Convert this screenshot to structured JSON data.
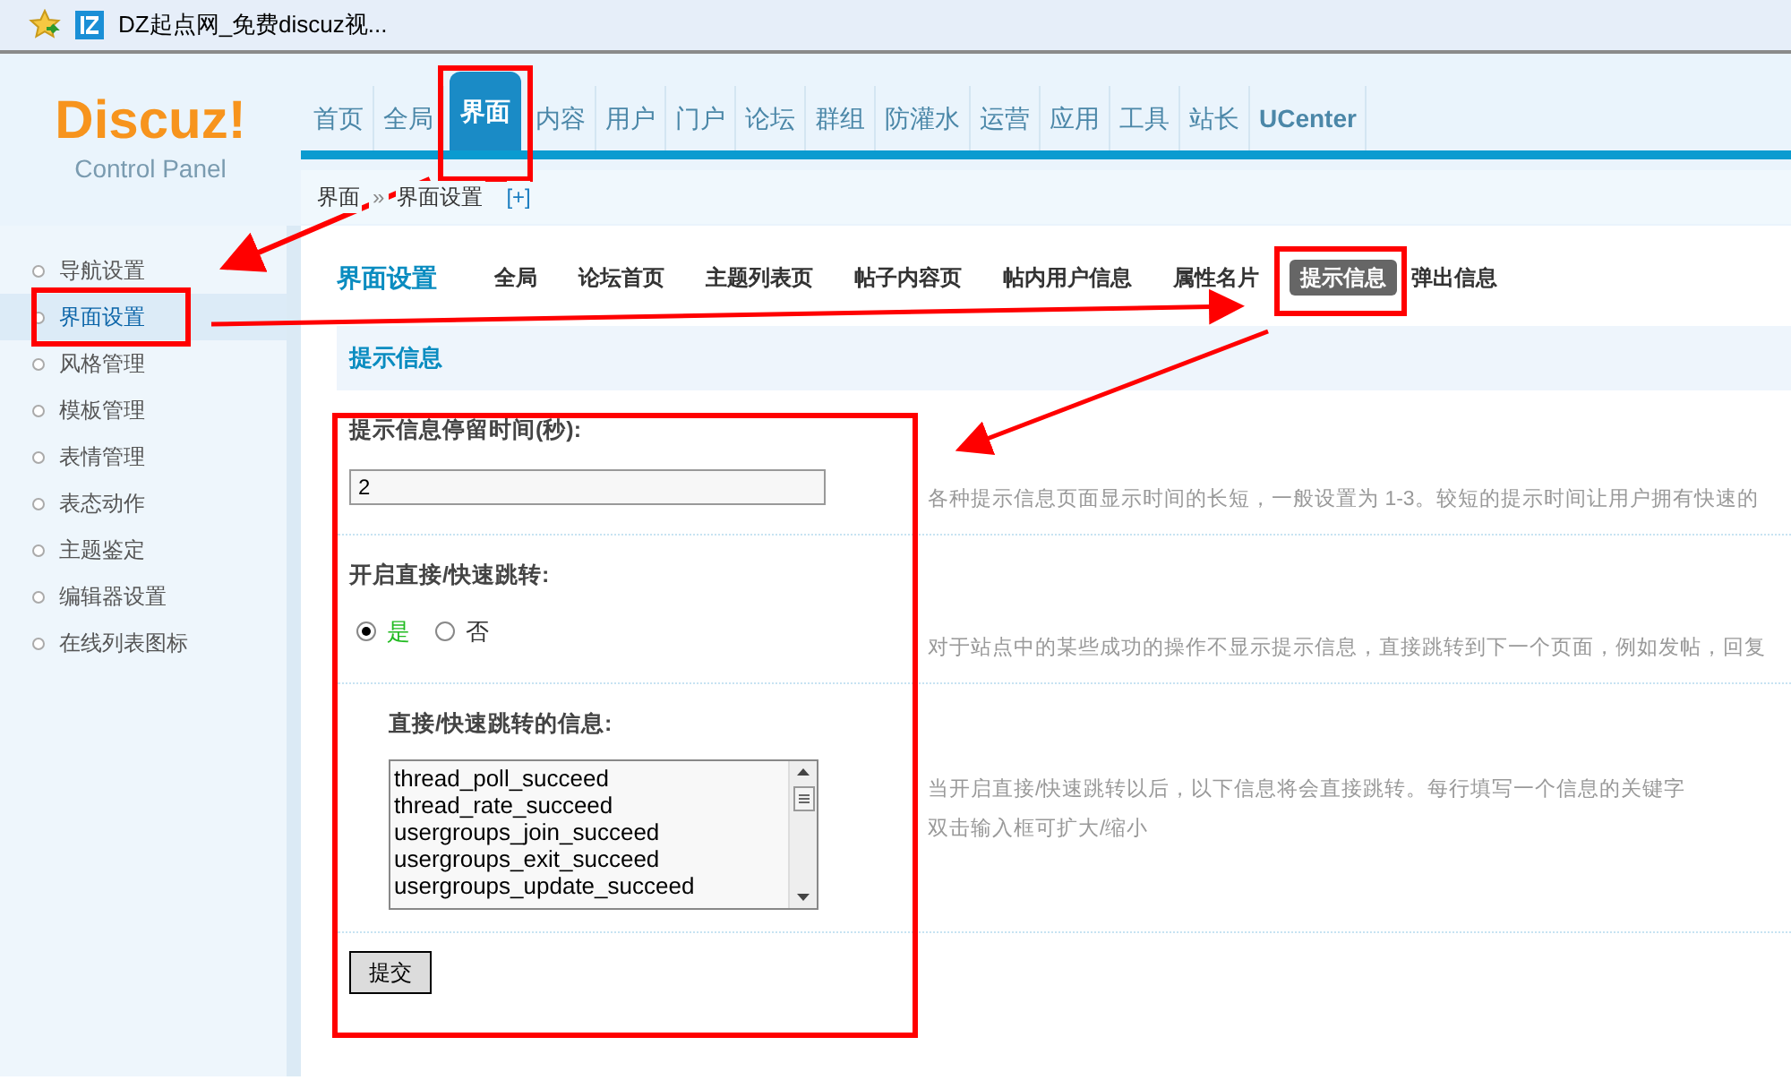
{
  "browser_tab": {
    "title": "DZ起点网_免费discuz视..."
  },
  "logo": {
    "name": "Discuz!",
    "subtitle": "Control Panel"
  },
  "nav": {
    "items": [
      {
        "label": "首页",
        "selected": false
      },
      {
        "label": "全局",
        "selected": false
      },
      {
        "label": "界面",
        "selected": true
      },
      {
        "label": "内容",
        "selected": false
      },
      {
        "label": "用户",
        "selected": false
      },
      {
        "label": "门户",
        "selected": false
      },
      {
        "label": "论坛",
        "selected": false
      },
      {
        "label": "群组",
        "selected": false
      },
      {
        "label": "防灌水",
        "selected": false
      },
      {
        "label": "运营",
        "selected": false
      },
      {
        "label": "应用",
        "selected": false
      },
      {
        "label": "工具",
        "selected": false
      },
      {
        "label": "站长",
        "selected": false
      },
      {
        "label": "UCenter",
        "selected": false
      }
    ]
  },
  "breadcrumb": {
    "path": [
      "界面",
      "界面设置"
    ],
    "separator": "»",
    "add": "[+]"
  },
  "sidebar": {
    "items": [
      {
        "label": "导航设置",
        "selected": false
      },
      {
        "label": "界面设置",
        "selected": true
      },
      {
        "label": "风格管理",
        "selected": false
      },
      {
        "label": "模板管理",
        "selected": false
      },
      {
        "label": "表情管理",
        "selected": false
      },
      {
        "label": "表态动作",
        "selected": false
      },
      {
        "label": "主题鉴定",
        "selected": false
      },
      {
        "label": "编辑器设置",
        "selected": false
      },
      {
        "label": "在线列表图标",
        "selected": false
      }
    ]
  },
  "page": {
    "title": "界面设置",
    "tabs": [
      {
        "label": "全局",
        "selected": false
      },
      {
        "label": "论坛首页",
        "selected": false
      },
      {
        "label": "主题列表页",
        "selected": false
      },
      {
        "label": "帖子内容页",
        "selected": false
      },
      {
        "label": "帖内用户信息",
        "selected": false
      },
      {
        "label": "属性名片",
        "selected": false
      },
      {
        "label": "提示信息",
        "selected": true
      },
      {
        "label": "弹出信息",
        "selected": false
      }
    ]
  },
  "section": {
    "title": "提示信息"
  },
  "settings": [
    {
      "kind": "text",
      "label": "提示信息停留时间(秒):",
      "value": "2",
      "help": [
        "各种提示信息页面显示时间的长短，一般设置为 1-3。较短的提示时间让用户拥有快速的"
      ]
    },
    {
      "kind": "radio",
      "label": "开启直接/快速跳转:",
      "options": [
        {
          "label": "是",
          "selected": true
        },
        {
          "label": "否",
          "selected": false
        }
      ],
      "help": [
        "对于站点中的某些成功的操作不显示提示信息，直接跳转到下一个页面，例如发帖，回复"
      ]
    },
    {
      "kind": "textarea",
      "label": "直接/快速跳转的信息:",
      "lines": [
        "thread_poll_succeed",
        "thread_rate_succeed",
        "usergroups_join_succeed",
        "usergroups_exit_succeed",
        "usergroups_update_succeed"
      ],
      "help": [
        "当开启直接/快速跳转以后，以下信息将会直接跳转。每行填写一个信息的关键字",
        "双击输入框可扩大/缩小"
      ]
    }
  ],
  "submit": "提交"
}
